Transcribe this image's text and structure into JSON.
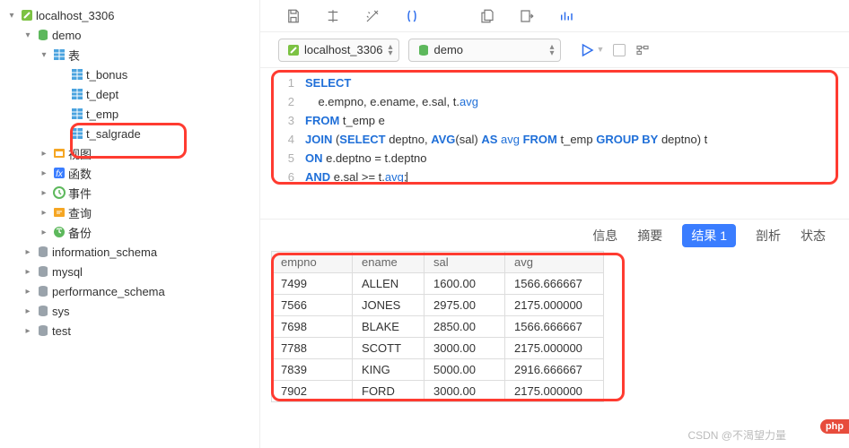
{
  "conn": {
    "name": "localhost_3306"
  },
  "db": {
    "name": "demo",
    "tables_label": "表"
  },
  "tables": [
    "t_bonus",
    "t_dept",
    "t_emp",
    "t_salgrade"
  ],
  "folders": {
    "views": "视图",
    "functions": "函数",
    "events": "事件",
    "queries": "查询",
    "backups": "备份"
  },
  "schemas": [
    "information_schema",
    "mysql",
    "performance_schema",
    "sys",
    "test"
  ],
  "toolbar": {
    "conn": "localhost_3306",
    "db": "demo"
  },
  "sql": {
    "l1a": "SELECT",
    "l2a": "e.empno, e.ename, e.sal, t.",
    "l2b": "avg",
    "l3a": "FROM",
    "l3b": " t_emp e",
    "l4a": "JOIN",
    "l4b": " (",
    "l4c": "SELECT",
    "l4d": " deptno, ",
    "l4e": "AVG",
    "l4f": "(sal) ",
    "l4g": "AS",
    "l4h": " ",
    "l4i": "avg",
    "l4j": " ",
    "l4k": "FROM",
    "l4l": " t_emp ",
    "l4m": "GROUP BY",
    "l4n": " deptno) t",
    "l5a": "ON",
    "l5b": " e.deptno = t.deptno",
    "l6a": "AND",
    "l6b": " e.sal >= t.",
    "l6c": "avg",
    "l6d": ";"
  },
  "lines": [
    "1",
    "2",
    "3",
    "4",
    "5",
    "6"
  ],
  "tabs": {
    "info": "信息",
    "summary": "摘要",
    "results": "结果 1",
    "analyze": "剖析",
    "status": "状态"
  },
  "columns": {
    "empno": "empno",
    "ename": "ename",
    "sal": "sal",
    "avg": "avg"
  },
  "rows": [
    {
      "empno": "7499",
      "ename": "ALLEN",
      "sal": "1600.00",
      "avg": "1566.666667"
    },
    {
      "empno": "7566",
      "ename": "JONES",
      "sal": "2975.00",
      "avg": "2175.000000"
    },
    {
      "empno": "7698",
      "ename": "BLAKE",
      "sal": "2850.00",
      "avg": "1566.666667"
    },
    {
      "empno": "7788",
      "ename": "SCOTT",
      "sal": "3000.00",
      "avg": "2175.000000"
    },
    {
      "empno": "7839",
      "ename": "KING",
      "sal": "5000.00",
      "avg": "2916.666667"
    },
    {
      "empno": "7902",
      "ename": "FORD",
      "sal": "3000.00",
      "avg": "2175.000000"
    }
  ],
  "watermark": "CSDN @不渴望力量",
  "badge": "php"
}
